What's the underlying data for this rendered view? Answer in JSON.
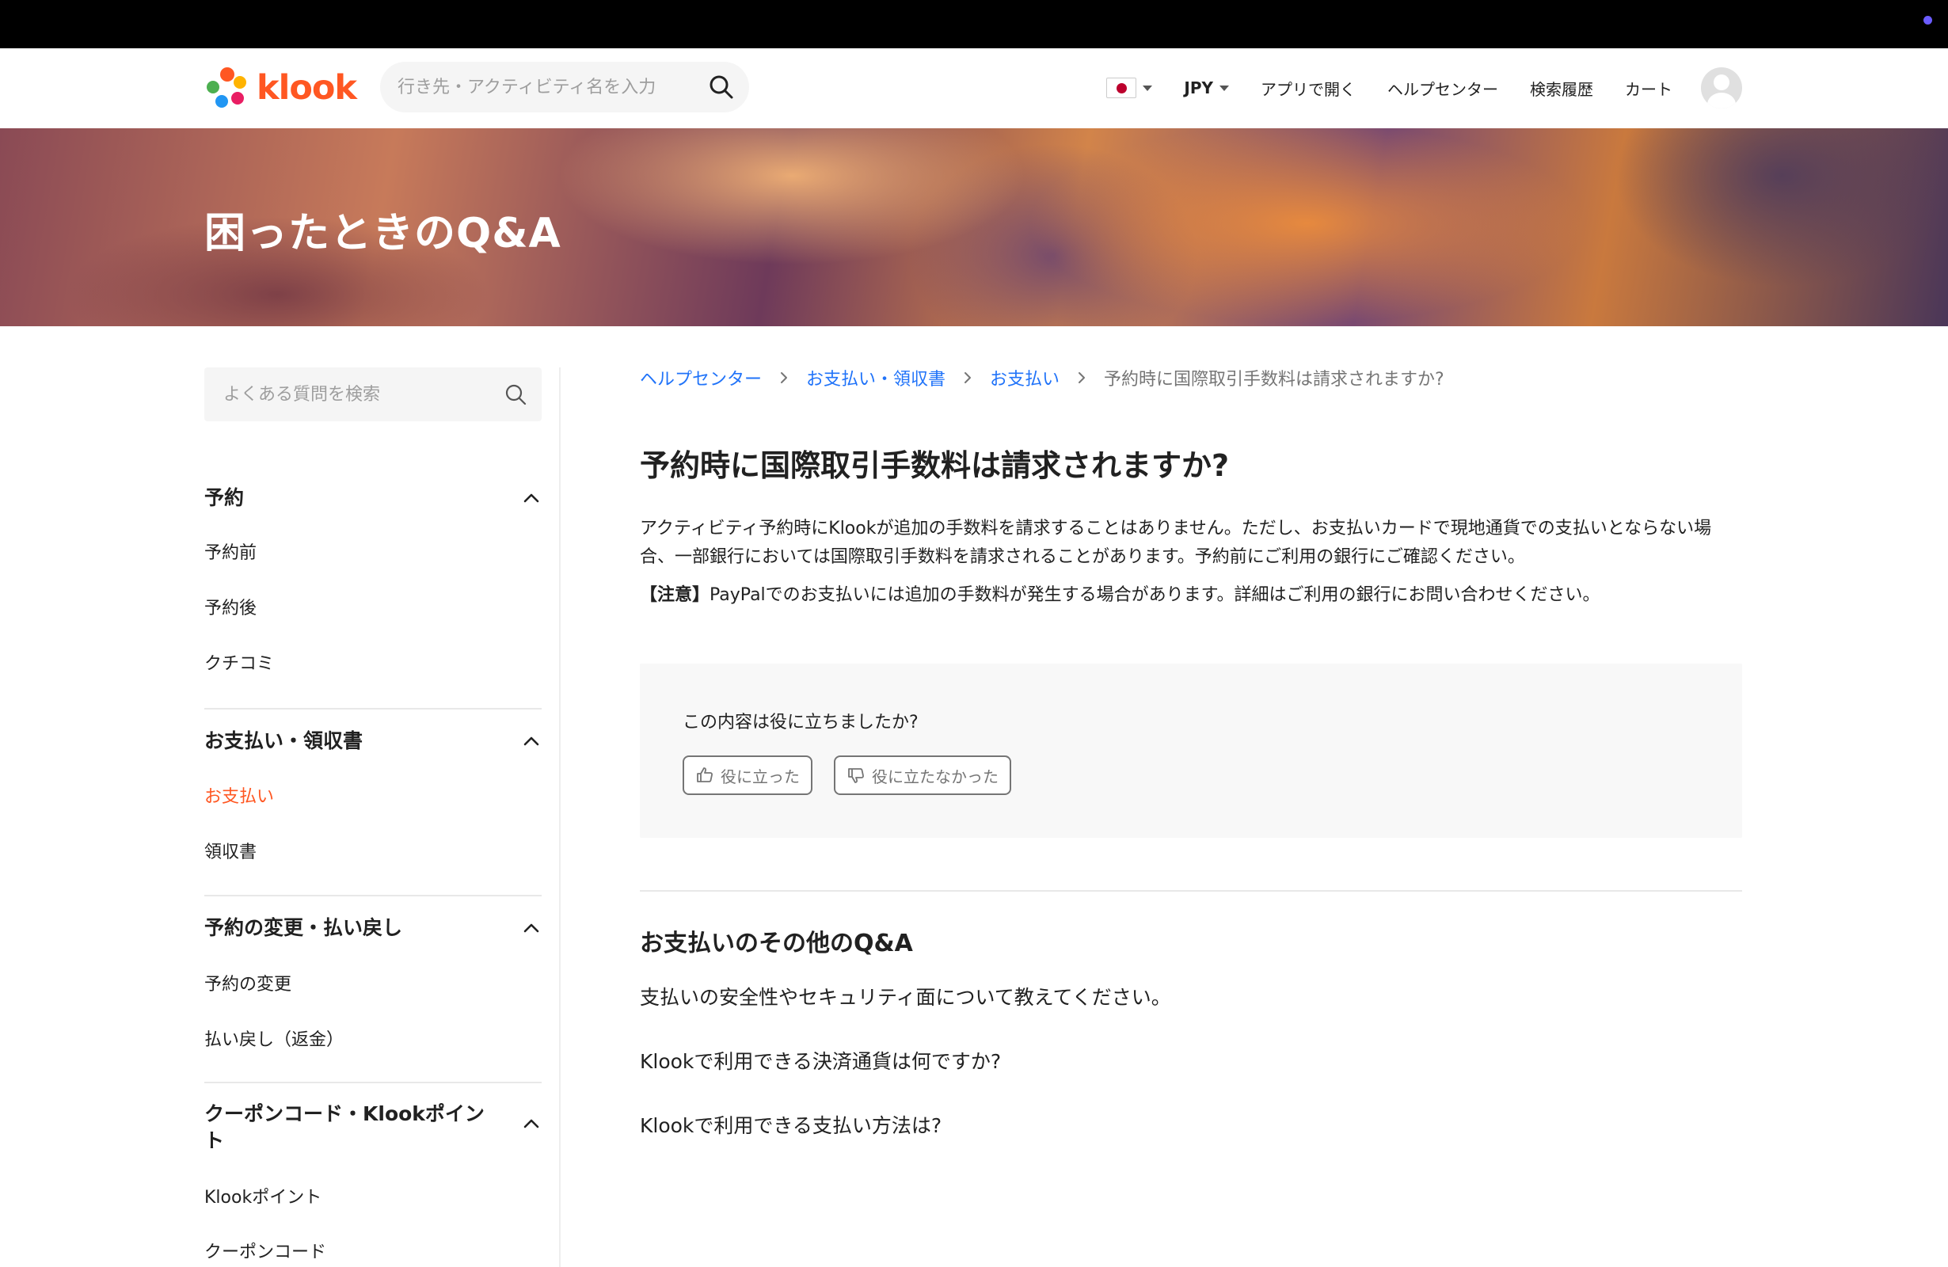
{
  "header": {
    "brand": "klook",
    "search_placeholder": "行き先・アクティビティ名を入力",
    "currency": "JPY",
    "nav": [
      "アプリで開く",
      "ヘルプセンター",
      "検索履歴",
      "カート"
    ]
  },
  "hero": {
    "title": "困ったときのQ&A"
  },
  "sidebar": {
    "search_placeholder": "よくある質問を検索",
    "categories": [
      {
        "title": "予約",
        "items": [
          "予約前",
          "予約後",
          "クチコミ"
        ]
      },
      {
        "title": "お支払い・領収書",
        "items": [
          "お支払い",
          "領収書"
        ],
        "active_item": "お支払い"
      },
      {
        "title": "予約の変更・払い戻し",
        "items": [
          "予約の変更",
          "払い戻し（返金）"
        ]
      },
      {
        "title": "クーポンコード・Klookポイント",
        "items": [
          "Klookポイント",
          "クーポンコード"
        ]
      }
    ]
  },
  "breadcrumb": [
    "ヘルプセンター",
    "お支払い・領収書",
    "お支払い",
    "予約時に国際取引手数料は請求されますか?"
  ],
  "article": {
    "title": "予約時に国際取引手数料は請求されますか?",
    "body": "アクティビティ予約時にKlookが追加の手数料を請求することはありません。ただし、お支払いカードで現地通貨での支払いとならない場合、一部銀行においては国際取引手数料を請求されることがあります。予約前にご利用の銀行にご確認ください。",
    "note_label": "【注意】",
    "note": "PayPalでのお支払いには追加の手数料が発生する場合があります。詳細はご利用の銀行にお問い合わせください。"
  },
  "feedback": {
    "question": "この内容は役に立ちましたか?",
    "yes": "役に立った",
    "no": "役に立たなかった"
  },
  "other": {
    "title": "お支払いのその他のQ&A",
    "items": [
      "支払いの安全性やセキュリティ面について教えてください。",
      "Klookで利用できる決済通貨は何ですか?",
      "Klookで利用できる支払い方法は?"
    ]
  },
  "colors": {
    "accent": "#ff5722",
    "link": "#2073f9"
  }
}
